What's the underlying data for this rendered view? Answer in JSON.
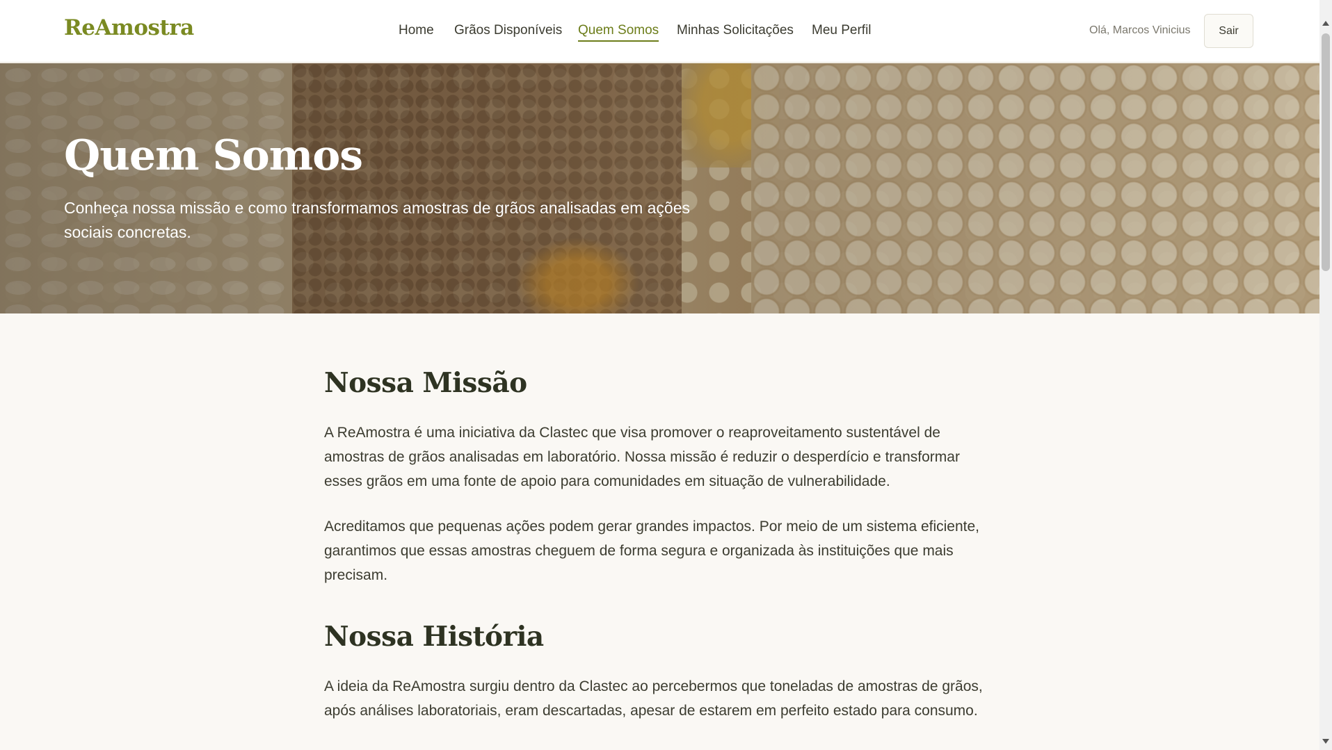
{
  "brand": "ReAmostra",
  "nav": {
    "items": [
      {
        "label": "Home",
        "active": false
      },
      {
        "label": "Grãos Disponíveis",
        "active": false
      },
      {
        "label": "Quem Somos",
        "active": true
      },
      {
        "label": "Minhas Solicitações",
        "active": false
      },
      {
        "label": "Meu Perfil",
        "active": false
      }
    ]
  },
  "user": {
    "greeting": "Olá, Marcos Vinicius",
    "logout_label": "Sair"
  },
  "hero": {
    "title": "Quem Somos",
    "subtitle": "Conheça nossa missão e como transformamos amostras de grãos analisadas em ações sociais concretas."
  },
  "sections": [
    {
      "title": "Nossa Missão",
      "paragraphs": [
        "A ReAmostra é uma iniciativa da Clastec que visa promover o reaproveitamento sustentável de amostras de grãos analisadas em laboratório. Nossa missão é reduzir o desperdício e transformar esses grãos em uma fonte de apoio para comunidades em situação de vulnerabilidade.",
        "Acreditamos que pequenas ações podem gerar grandes impactos. Por meio de um sistema eficiente, garantimos que essas amostras cheguem de forma segura e organizada às instituições que mais precisam."
      ]
    },
    {
      "title": "Nossa História",
      "paragraphs": [
        "A ideia da ReAmostra surgiu dentro da Clastec ao percebermos que toneladas de amostras de grãos, após análises laboratoriais, eram descartadas, apesar de estarem em perfeito estado para consumo."
      ]
    }
  ],
  "colors": {
    "brand": "#7a8a22",
    "active_nav": "#6c7d1a",
    "heading": "#2e3322",
    "page_bg": "#faf8f4"
  }
}
